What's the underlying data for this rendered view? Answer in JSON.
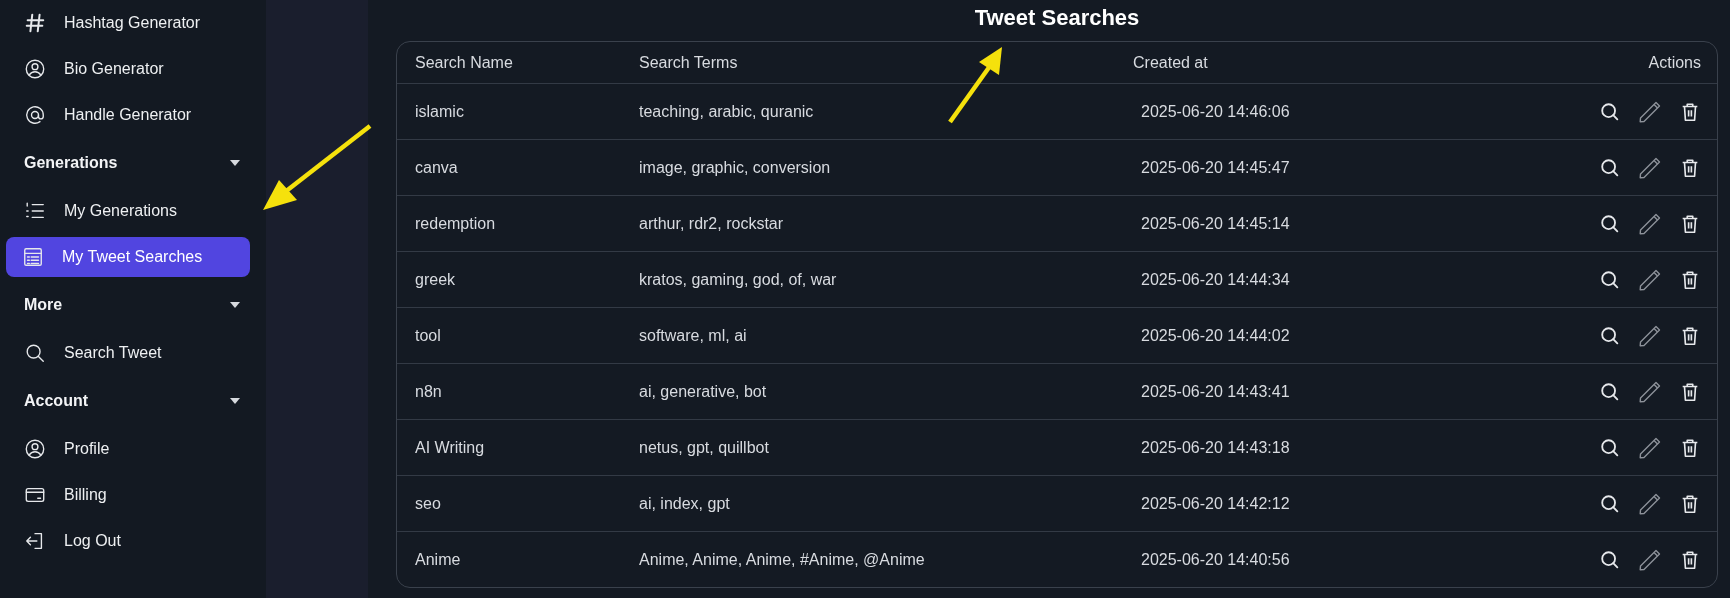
{
  "sidebar": {
    "sections": [
      {
        "items": [
          {
            "label": "Hashtag Generator",
            "selected": false
          },
          {
            "label": "Bio Generator",
            "selected": false
          },
          {
            "label": "Handle Generator",
            "selected": false
          }
        ]
      },
      {
        "heading": "Generations",
        "expanded": true,
        "items": [
          {
            "label": "My Generations",
            "selected": false
          },
          {
            "label": "My Tweet Searches",
            "selected": true
          }
        ]
      },
      {
        "heading": "More",
        "expanded": true,
        "items": [
          {
            "label": "Search Tweet",
            "selected": false
          }
        ]
      },
      {
        "heading": "Account",
        "expanded": true,
        "items": [
          {
            "label": "Profile",
            "selected": false
          },
          {
            "label": "Billing",
            "selected": false
          },
          {
            "label": "Log Out",
            "selected": false
          }
        ]
      }
    ]
  },
  "page": {
    "title": "Tweet Searches"
  },
  "table": {
    "columns": [
      "Search Name",
      "Search Terms",
      "Created at",
      "Actions"
    ],
    "rows": [
      {
        "name": "islamic",
        "terms": "teaching, arabic, quranic",
        "created": "2025-06-20 14:46:06"
      },
      {
        "name": "canva",
        "terms": "image, graphic, conversion",
        "created": "2025-06-20 14:45:47"
      },
      {
        "name": "redemption",
        "terms": "arthur, rdr2, rockstar",
        "created": "2025-06-20 14:45:14"
      },
      {
        "name": "greek",
        "terms": "kratos, gaming, god, of, war",
        "created": "2025-06-20 14:44:34"
      },
      {
        "name": "tool",
        "terms": "software, ml, ai",
        "created": "2025-06-20 14:44:02"
      },
      {
        "name": "n8n",
        "terms": "ai, generative, bot",
        "created": "2025-06-20 14:43:41"
      },
      {
        "name": "AI Writing",
        "terms": "netus, gpt, quillbot",
        "created": "2025-06-20 14:43:18"
      },
      {
        "name": "seo",
        "terms": "ai, index, gpt",
        "created": "2025-06-20 14:42:12"
      },
      {
        "name": "Anime",
        "terms": "Anime, Anime, Anime, #Anime, @Anime",
        "created": "2025-06-20 14:40:56"
      }
    ]
  }
}
